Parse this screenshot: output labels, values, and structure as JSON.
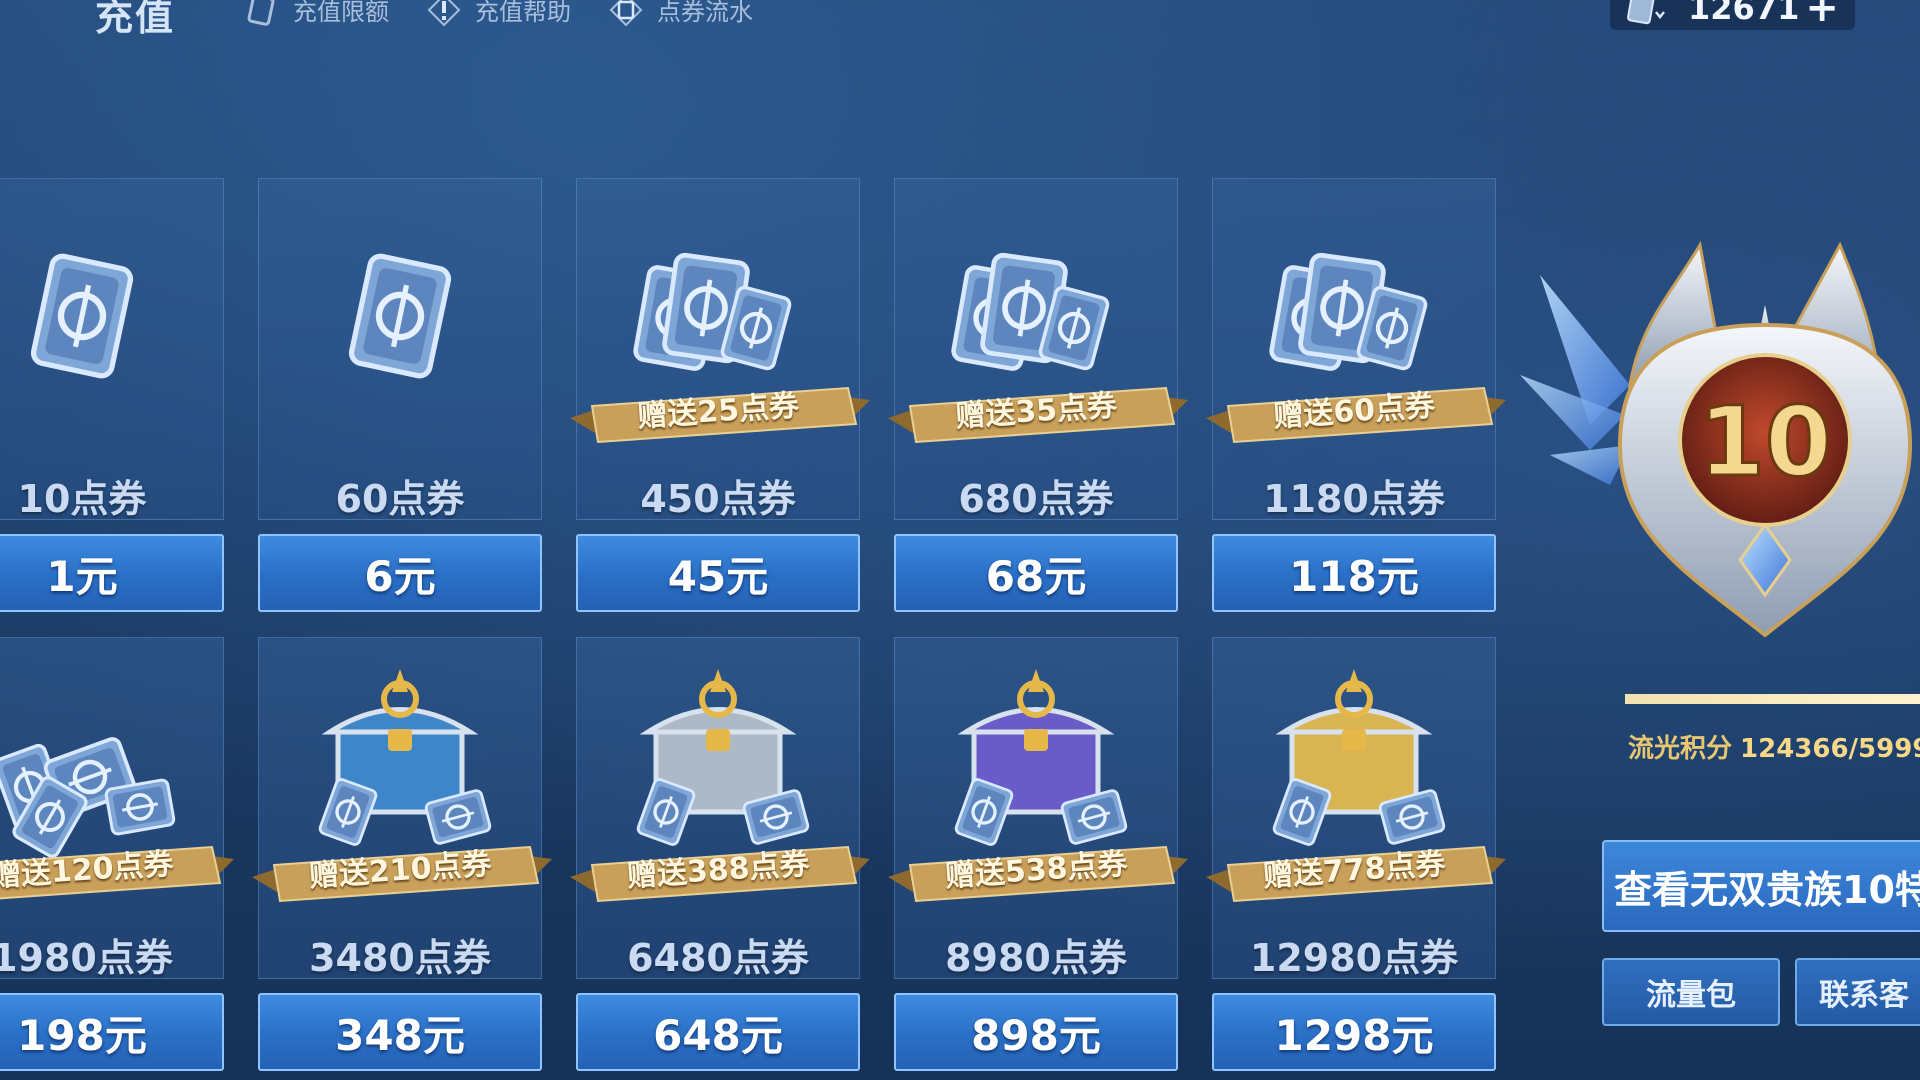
{
  "header": {
    "title": "充值",
    "nav": [
      {
        "label": "充值限额",
        "icon": "card-icon"
      },
      {
        "label": "充值帮助",
        "icon": "exclamation-icon"
      },
      {
        "label": "点券流水",
        "icon": "ticket-icon"
      }
    ],
    "currency": {
      "icon": "voucher-icon",
      "value": "12671",
      "add": "+"
    }
  },
  "products": [
    {
      "amount": "10点券",
      "price": "1元",
      "bonus": "",
      "art": "single-voucher"
    },
    {
      "amount": "60点券",
      "price": "6元",
      "bonus": "",
      "art": "single-voucher"
    },
    {
      "amount": "450点券",
      "price": "45元",
      "bonus": "赠送25点券",
      "art": "voucher-stack"
    },
    {
      "amount": "680点券",
      "price": "68元",
      "bonus": "赠送35点券",
      "art": "voucher-stack"
    },
    {
      "amount": "1180点券",
      "price": "118元",
      "bonus": "赠送60点券",
      "art": "voucher-stack"
    },
    {
      "amount": "1980点券",
      "price": "198元",
      "bonus": "赠送120点券",
      "art": "voucher-pile"
    },
    {
      "amount": "3480点券",
      "price": "348元",
      "bonus": "赠送210点券",
      "art": "chest-blue"
    },
    {
      "amount": "6480点券",
      "price": "648元",
      "bonus": "赠送388点券",
      "art": "chest-silver"
    },
    {
      "amount": "8980点券",
      "price": "898元",
      "bonus": "赠送538点券",
      "art": "chest-purple"
    },
    {
      "amount": "12980点券",
      "price": "1298元",
      "bonus": "赠送778点券",
      "art": "chest-gold"
    }
  ],
  "vip": {
    "level": "10",
    "progress": 1.0,
    "points_label": "流光积分",
    "points_value": "124366/5999",
    "detail_button": "查看无双贵族10特",
    "buttons": [
      "流量包",
      "联系客"
    ]
  },
  "colors": {
    "price_button": "#2f77d0",
    "ribbon_gold": "#c9a05a",
    "points_gold": "#e9c772"
  }
}
